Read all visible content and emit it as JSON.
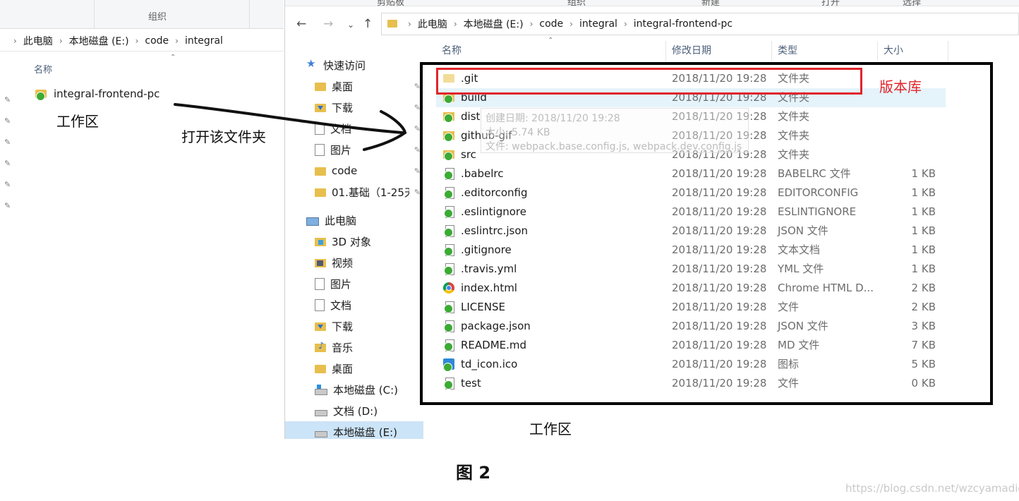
{
  "left_window": {
    "ribbon_group": "组织",
    "breadcrumbs": [
      "此电脑",
      "本地磁盘 (E:)",
      "code",
      "integral"
    ],
    "column_name": "名称",
    "items": [
      {
        "name": "integral-frontend-pc"
      }
    ]
  },
  "main_window": {
    "ribbon_tabs": [
      "剪贴板",
      "组织",
      "新建",
      "打开",
      "选择"
    ],
    "breadcrumbs": [
      "此电脑",
      "本地磁盘 (E:)",
      "code",
      "integral",
      "integral-frontend-pc"
    ],
    "nav_items": [
      {
        "label": "快速访问",
        "icon": "star-icon",
        "pinned": false,
        "kind": "star"
      },
      {
        "label": "桌面",
        "icon": "folder-icon",
        "pinned": true,
        "kind": "folder"
      },
      {
        "label": "下载",
        "icon": "download-folder-icon",
        "pinned": true,
        "kind": "folderdown"
      },
      {
        "label": "文档",
        "icon": "document-icon",
        "pinned": true,
        "kind": "doc"
      },
      {
        "label": "图片",
        "icon": "picture-icon",
        "pinned": true,
        "kind": "pic"
      },
      {
        "label": "code",
        "icon": "folder-icon",
        "pinned": true,
        "kind": "folder"
      },
      {
        "label": "01.基础（1-25天",
        "icon": "folder-icon",
        "pinned": true,
        "kind": "folder"
      },
      {
        "label": "此电脑",
        "icon": "pc-icon",
        "pinned": false,
        "kind": "pc"
      },
      {
        "label": "3D 对象",
        "icon": "3d-objects-icon",
        "pinned": false,
        "kind": "3d"
      },
      {
        "label": "视频",
        "icon": "video-icon",
        "pinned": false,
        "kind": "video"
      },
      {
        "label": "图片",
        "icon": "picture-icon",
        "pinned": false,
        "kind": "pic"
      },
      {
        "label": "文档",
        "icon": "document-icon",
        "pinned": false,
        "kind": "doc"
      },
      {
        "label": "下载",
        "icon": "download-folder-icon",
        "pinned": false,
        "kind": "folderdown"
      },
      {
        "label": "音乐",
        "icon": "music-icon",
        "pinned": false,
        "kind": "music"
      },
      {
        "label": "桌面",
        "icon": "folder-icon",
        "pinned": false,
        "kind": "folder"
      },
      {
        "label": "本地磁盘 (C:)",
        "icon": "windows-drive-icon",
        "pinned": false,
        "kind": "drivewin"
      },
      {
        "label": "文档 (D:)",
        "icon": "drive-icon",
        "pinned": false,
        "kind": "drive"
      },
      {
        "label": "本地磁盘 (E:)",
        "icon": "drive-icon",
        "pinned": false,
        "kind": "drive"
      }
    ],
    "columns": [
      "名称",
      "修改日期",
      "类型",
      "大小"
    ],
    "files": [
      {
        "name": ".git",
        "date": "2018/11/20 19:28",
        "type": "文件夹",
        "size": "",
        "icon": "gitfolder"
      },
      {
        "name": "build",
        "date": "2018/11/20 19:28",
        "type": "文件夹",
        "size": "",
        "icon": "folderok"
      },
      {
        "name": "dist",
        "date": "2018/11/20 19:28",
        "type": "文件夹",
        "size": "",
        "icon": "folderok"
      },
      {
        "name": "github-gif",
        "date": "2018/11/20 19:28",
        "type": "文件夹",
        "size": "",
        "icon": "folderok"
      },
      {
        "name": "src",
        "date": "2018/11/20 19:28",
        "type": "文件夹",
        "size": "",
        "icon": "folderok"
      },
      {
        "name": ".babelrc",
        "date": "2018/11/20 19:28",
        "type": "BABELRC 文件",
        "size": "1 KB",
        "icon": "fileok"
      },
      {
        "name": ".editorconfig",
        "date": "2018/11/20 19:28",
        "type": "EDITORCONFIG",
        "size": "1 KB",
        "icon": "fileok"
      },
      {
        "name": ".eslintignore",
        "date": "2018/11/20 19:28",
        "type": "ESLINTIGNORE",
        "size": "1 KB",
        "icon": "fileok"
      },
      {
        "name": ".eslintrc.json",
        "date": "2018/11/20 19:28",
        "type": "JSON 文件",
        "size": "1 KB",
        "icon": "fileok"
      },
      {
        "name": ".gitignore",
        "date": "2018/11/20 19:28",
        "type": "文本文档",
        "size": "1 KB",
        "icon": "fileok"
      },
      {
        "name": ".travis.yml",
        "date": "2018/11/20 19:28",
        "type": "YML 文件",
        "size": "1 KB",
        "icon": "fileok"
      },
      {
        "name": "index.html",
        "date": "2018/11/20 19:28",
        "type": "Chrome HTML D...",
        "size": "2 KB",
        "icon": "chrome"
      },
      {
        "name": "LICENSE",
        "date": "2018/11/20 19:28",
        "type": "文件",
        "size": "2 KB",
        "icon": "fileok"
      },
      {
        "name": "package.json",
        "date": "2018/11/20 19:28",
        "type": "JSON 文件",
        "size": "3 KB",
        "icon": "fileok"
      },
      {
        "name": "README.md",
        "date": "2018/11/20 19:28",
        "type": "MD 文件",
        "size": "7 KB",
        "icon": "fileok"
      },
      {
        "name": "td_icon.ico",
        "date": "2018/11/20 19:28",
        "type": "图标",
        "size": "5 KB",
        "icon": "ico"
      },
      {
        "name": "test",
        "date": "2018/11/20 19:28",
        "type": "文件",
        "size": "0 KB",
        "icon": "fileok"
      }
    ],
    "tooltip_lines": [
      "创建日期: 2018/11/20 19:28",
      "大小: 5.74 KB",
      "文件: webpack.base.config.js, webpack.dev.config.js"
    ]
  },
  "annotations": {
    "workspace_left": "工作区",
    "open_folder": "打开该文件夹",
    "repository": "版本库",
    "workspace_bottom": "工作区",
    "figure_caption": "图 2",
    "watermark": "https://blog.csdn.net/wzcyamadie"
  },
  "colors": {
    "annotation_red": "#e0252b",
    "selection_blue": "#cce4f7",
    "hover_blue": "#e5f3fb",
    "folder_yellow": "#e8bf4e"
  }
}
